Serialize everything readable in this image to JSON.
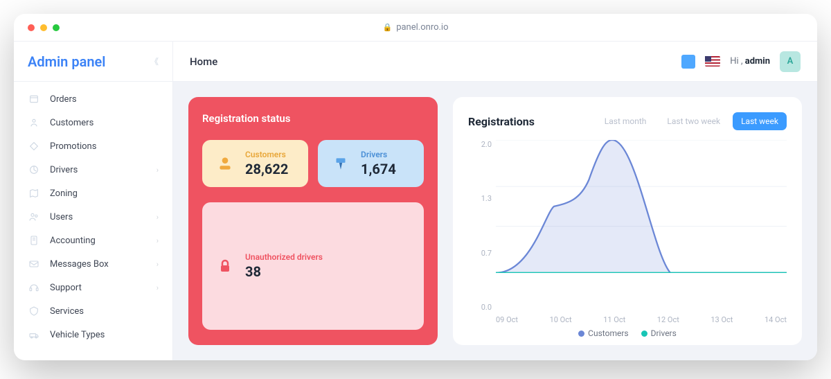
{
  "url": "panel.onro.io",
  "brand": "Admin panel",
  "breadcrumb": "Home",
  "greeting_prefix": "Hi ,",
  "greeting_user": "admin",
  "avatar_initial": "A",
  "sidebar": {
    "items": [
      {
        "label": "Orders",
        "icon": "orders",
        "expandable": false
      },
      {
        "label": "Customers",
        "icon": "customers",
        "expandable": false
      },
      {
        "label": "Promotions",
        "icon": "promotions",
        "expandable": false
      },
      {
        "label": "Drivers",
        "icon": "drivers",
        "expandable": true
      },
      {
        "label": "Zoning",
        "icon": "zoning",
        "expandable": false
      },
      {
        "label": "Users",
        "icon": "users",
        "expandable": true
      },
      {
        "label": "Accounting",
        "icon": "accounting",
        "expandable": true
      },
      {
        "label": "Messages Box",
        "icon": "messages",
        "expandable": true
      },
      {
        "label": "Support",
        "icon": "support",
        "expandable": true
      },
      {
        "label": "Services",
        "icon": "services",
        "expandable": false
      },
      {
        "label": "Vehicle Types",
        "icon": "vehicle",
        "expandable": false
      }
    ]
  },
  "registration_card": {
    "title": "Registration status",
    "customers": {
      "label": "Customers",
      "value": "28,622"
    },
    "drivers": {
      "label": "Drivers",
      "value": "1,674"
    },
    "unauthorized": {
      "label": "Unauthorized drivers",
      "value": "38"
    }
  },
  "registrations_chart": {
    "title": "Registrations",
    "ranges": [
      "Last month",
      "Last two week",
      "Last week"
    ],
    "active_range": "Last week",
    "legend": [
      "Customers",
      "Drivers"
    ],
    "colors": {
      "customers": "#6b87d6",
      "drivers": "#18c5b5"
    }
  },
  "chart_data": {
    "type": "area",
    "xlabel": "",
    "ylabel": "",
    "ylim": [
      0.0,
      2.0
    ],
    "yticks": [
      2.0,
      1.3,
      0.7,
      0.0
    ],
    "categories": [
      "09 Oct",
      "10 Oct",
      "11 Oct",
      "12 Oct",
      "13 Oct",
      "14 Oct"
    ],
    "series": [
      {
        "name": "Customers",
        "values": [
          0.0,
          1.0,
          2.0,
          0.0,
          0.0,
          0.0
        ]
      },
      {
        "name": "Drivers",
        "values": [
          0.0,
          0.0,
          0.0,
          0.0,
          0.0,
          0.0
        ]
      }
    ]
  }
}
